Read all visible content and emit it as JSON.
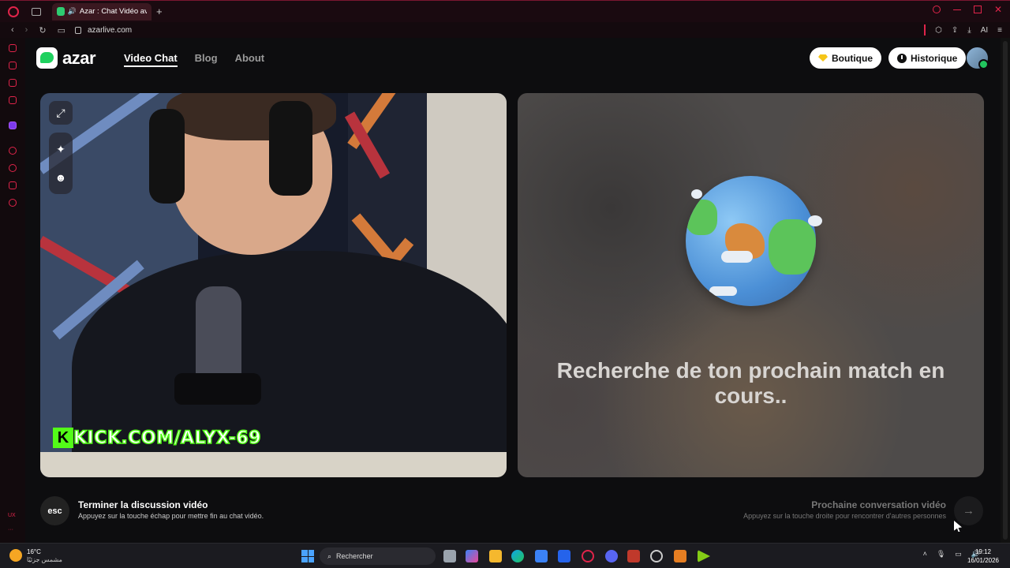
{
  "browser": {
    "tab_title": "Azar : Chat Vidéo avec",
    "url": "azarlive.com",
    "ai_label": "AI",
    "sidebar_label": "UX"
  },
  "site": {
    "logo_text": "azar",
    "nav": [
      {
        "label": "Video Chat",
        "active": true
      },
      {
        "label": "Blog",
        "active": false
      },
      {
        "label": "About",
        "active": false
      }
    ],
    "shop_label": "Boutique",
    "history_label": "Historique"
  },
  "video_left": {
    "overlay_text": "KICK.COM/ALYX-69",
    "tools": [
      "expand-icon",
      "magic-wand-icon",
      "sticker-face-icon"
    ]
  },
  "video_right": {
    "status_text": "Recherche de ton prochain match en cours.."
  },
  "controls": {
    "esc_key": "esc",
    "end_title": "Terminer la discussion vidéo",
    "end_subtitle": "Appuyez sur la touche échap pour mettre fin au chat vidéo.",
    "next_title": "Prochaine conversation vidéo",
    "next_subtitle": "Appuyez sur la touche droite pour rencontrer d'autres personnes"
  },
  "taskbar": {
    "temperature": "16°C",
    "weather_desc": "مشمس جزئيًا",
    "search_placeholder": "Rechercher",
    "time": "19:12",
    "date": "16/01/2026"
  },
  "colors": {
    "brand_green": "#1fd15f",
    "kick_green": "#53fc18",
    "opera_red": "#e0244a"
  }
}
